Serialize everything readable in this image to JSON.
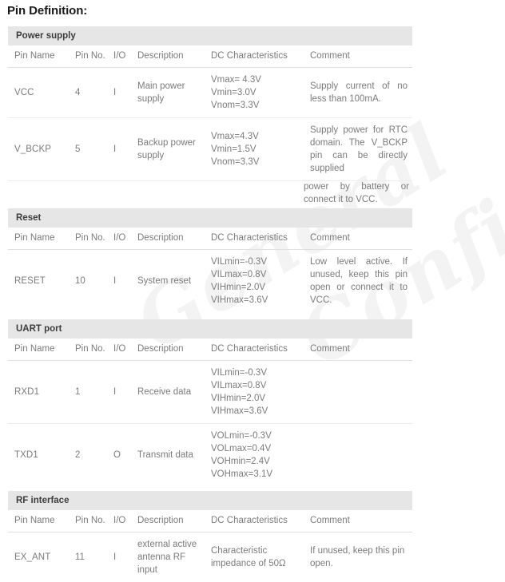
{
  "document": {
    "title": "Pin Definition:",
    "watermark": {
      "line1": "General",
      "line2": "Confidential"
    }
  },
  "columns": {
    "pin_name": "Pin Name",
    "pin_no": "Pin No.",
    "io": "I/O",
    "description": "Description",
    "dc": "DC Characteristics",
    "comment": "Comment"
  },
  "sections": [
    {
      "title": "Power supply",
      "rows": [
        {
          "pin_name": "VCC",
          "pin_no": "4",
          "io": "I",
          "description": "Main power supply",
          "dc": [
            "Vmax= 4.3V",
            "Vmin=3.0V",
            "Vnom=3.3V"
          ],
          "comment": "Supply current of no less than 100mA."
        },
        {
          "pin_name": "V_BCKP",
          "pin_no": "5",
          "io": "I",
          "description": "Backup power supply",
          "dc": [
            "Vmax=4.3V",
            "Vmin=1.5V",
            "Vnom=3.3V"
          ],
          "comment": "Supply power for RTC domain. The V_BCKP pin can be directly supplied",
          "comment_overflow": "power by battery or connect it to VCC."
        }
      ]
    },
    {
      "title": "Reset",
      "rows": [
        {
          "pin_name": "RESET",
          "pin_no": "10",
          "io": "I",
          "description": "System reset",
          "dc": [
            "VILmin=-0.3V",
            "VILmax=0.8V",
            "VIHmin=2.0V",
            "VIHmax=3.6V"
          ],
          "comment": "Low level active. If unused, keep this pin open or connect it to VCC."
        }
      ]
    },
    {
      "title": "UART port",
      "rows": [
        {
          "pin_name": "RXD1",
          "pin_no": "1",
          "io": "I",
          "description": "Receive data",
          "dc": [
            "VILmin=-0.3V",
            "VILmax=0.8V",
            "VIHmin=2.0V",
            "VIHmax=3.6V"
          ],
          "comment": ""
        },
        {
          "pin_name": "TXD1",
          "pin_no": "2",
          "io": "O",
          "description": "Transmit data",
          "dc": [
            "VOLmin=-0.3V",
            "VOLmax=0.4V",
            "VOHmin=2.4V",
            "VOHmax=3.1V"
          ],
          "comment": ""
        }
      ]
    },
    {
      "title": "RF interface",
      "rows": [
        {
          "pin_name": "EX_ANT",
          "pin_no": "11",
          "io": "I",
          "description": "external active antenna RF input",
          "dc": [
            "Characteristic",
            "impedance of 50Ω"
          ],
          "comment": "If unused, keep this pin open."
        }
      ]
    }
  ],
  "colors": {
    "section_band": "#e6e6e6",
    "text": "#7b7b7b",
    "title": "#1a1a1a",
    "rule": "#ececec"
  }
}
